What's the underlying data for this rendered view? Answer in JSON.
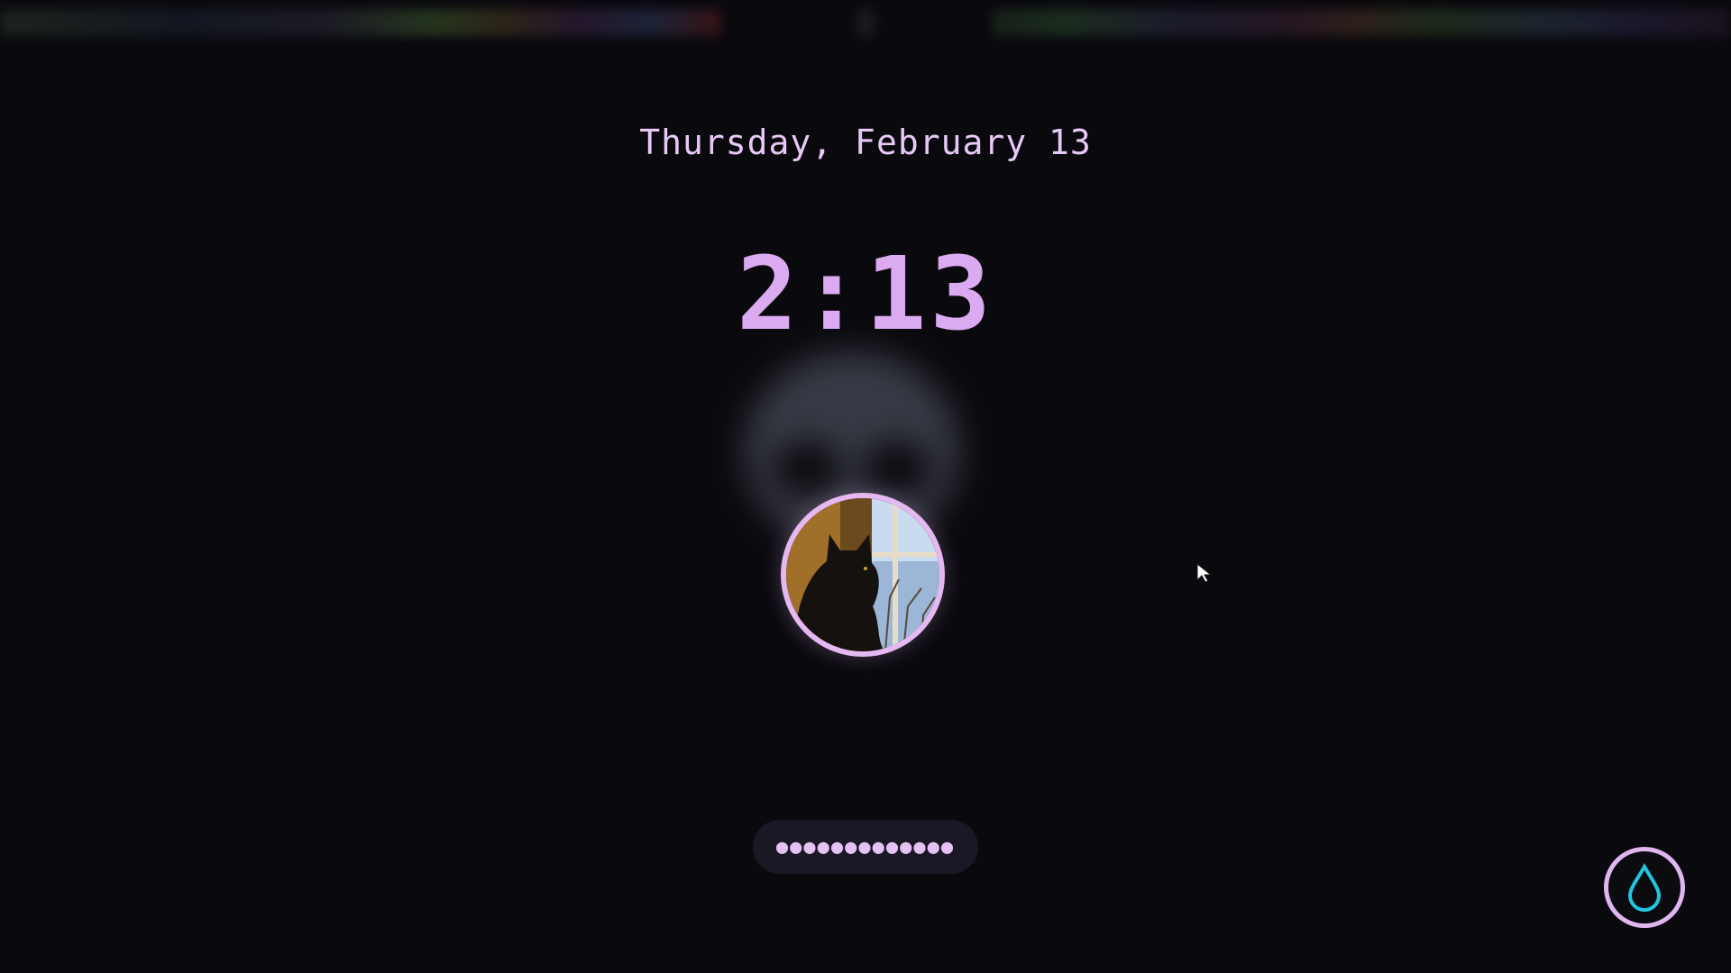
{
  "lockscreen": {
    "date": "Thursday, February 13",
    "time": "2:13",
    "password_dots": "●●●●●●●●●●●●●",
    "avatar": "user-avatar-black-cat-window",
    "power_icon": "water-drop-icon"
  },
  "colors": {
    "background": "#0a090e",
    "accent": "#e5b8f2",
    "clock": "#dcaaf0",
    "field_bg": "#1b1724",
    "drop": "#22c4e0"
  }
}
